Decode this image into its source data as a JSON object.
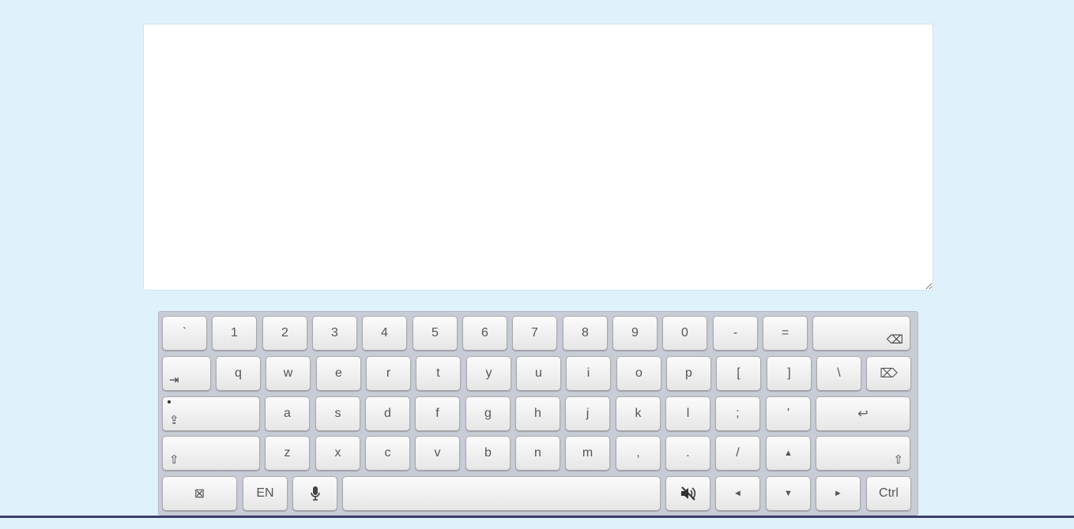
{
  "editor": {
    "value": "",
    "placeholder": ""
  },
  "keyboard": {
    "row1": [
      "`",
      "1",
      "2",
      "3",
      "4",
      "5",
      "6",
      "7",
      "8",
      "9",
      "0",
      "-",
      "="
    ],
    "row2": [
      "q",
      "w",
      "e",
      "r",
      "t",
      "y",
      "u",
      "i",
      "o",
      "p",
      "[",
      "]",
      "\\"
    ],
    "row3": [
      "a",
      "s",
      "d",
      "f",
      "g",
      "h",
      "j",
      "k",
      "l",
      ";",
      "'"
    ],
    "row4": [
      "z",
      "x",
      "c",
      "v",
      "b",
      "n",
      "m",
      ",",
      ".",
      "/"
    ],
    "backspace_glyph": "⌫",
    "tab_glyph": "⇥",
    "delete_glyph": "⌦",
    "capslock_glyph": "⇪",
    "enter_glyph": "↩",
    "shift_glyph": "⇧",
    "up_glyph": "▲",
    "down_glyph": "▼",
    "left_glyph": "◄",
    "right_glyph": "►",
    "close_glyph": "⊠",
    "lang_label": "EN",
    "ctrl_label": "Ctrl",
    "icons": {
      "mic": "microphone-icon",
      "mute": "speaker-muted-icon"
    }
  }
}
